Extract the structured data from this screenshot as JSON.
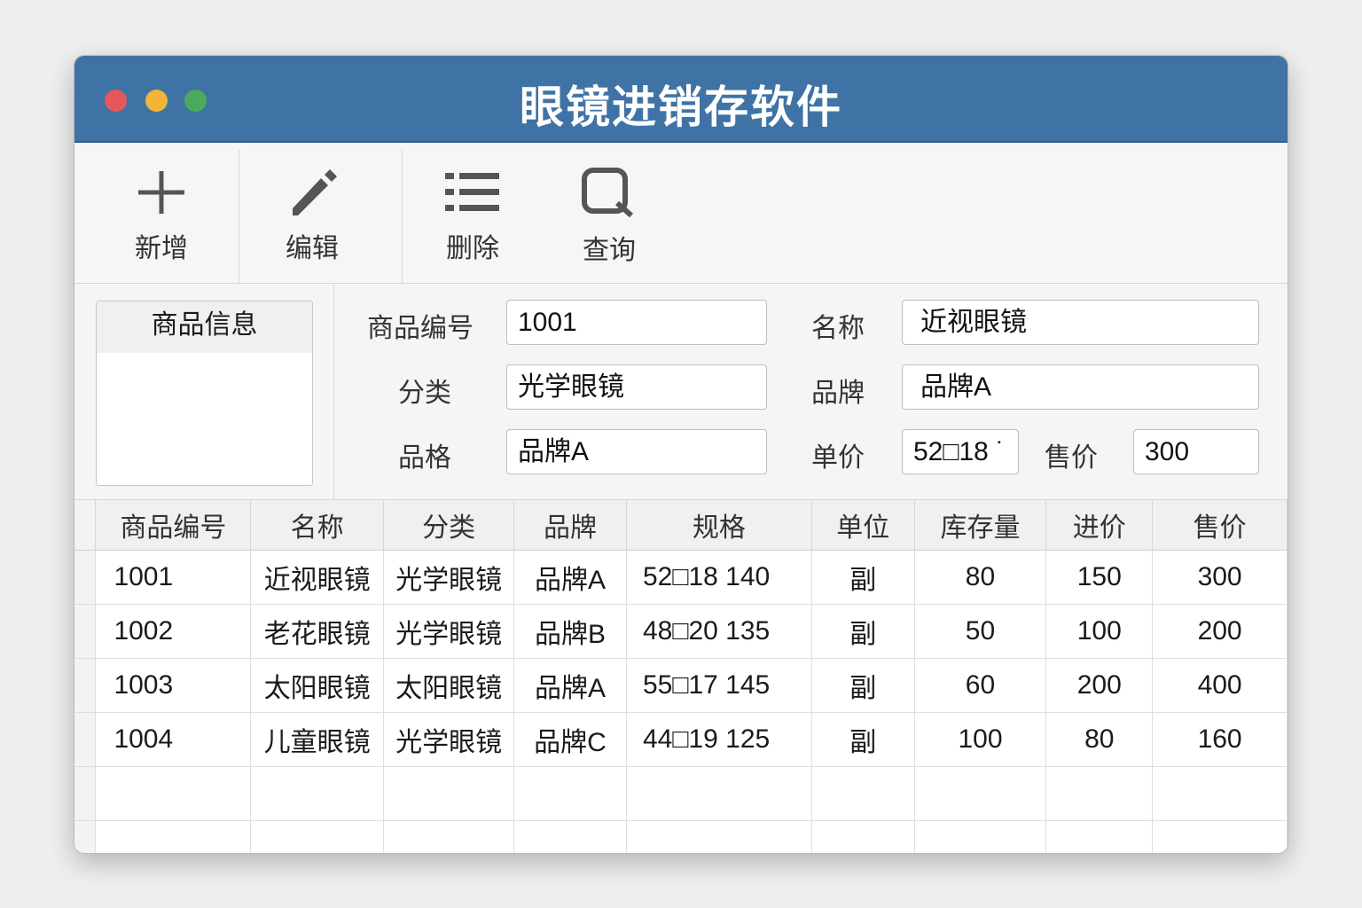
{
  "window": {
    "title": "眼镜进销存软件",
    "traffic_lights": [
      "#e5585a",
      "#f2b538",
      "#4caa5e"
    ]
  },
  "toolbar": {
    "add": "新增",
    "edit": "编辑",
    "delete": "删除",
    "query": "查询"
  },
  "panel": {
    "title": "商品信息"
  },
  "form": {
    "id_label": "商品编号",
    "id_value": "1001",
    "name_label": "名称",
    "name_value": "近视眼镜",
    "category_label": "分类",
    "category_value": "光学眼镜",
    "brand_label": "品牌",
    "brand_value": "品牌A",
    "spec_label": "品格",
    "spec_value": "品牌A",
    "unit_price_label": "单价",
    "unit_price_value": "52□18 ˙",
    "sale_price_label": "售价",
    "sale_price_value": "300"
  },
  "table": {
    "headers": [
      "商品编号",
      "名称",
      "分类",
      "品牌",
      "规格",
      "单位",
      "库存量",
      "进价",
      "售价"
    ],
    "rows": [
      [
        "1001",
        "近视眼镜",
        "光学眼镜",
        "品牌A",
        "52□18 140",
        "副",
        "80",
        "150",
        "300"
      ],
      [
        "1002",
        "老花眼镜",
        "光学眼镜",
        "品牌B",
        "48□20 135",
        "副",
        "50",
        "100",
        "200"
      ],
      [
        "1003",
        "太阳眼镜",
        "太阳眼镜",
        "品牌A",
        "55□17 145",
        "副",
        "60",
        "200",
        "400"
      ],
      [
        "1004",
        "儿童眼镜",
        "光学眼镜",
        "品牌C",
        "44□19 125",
        "副",
        "100",
        "80",
        "160"
      ]
    ]
  }
}
